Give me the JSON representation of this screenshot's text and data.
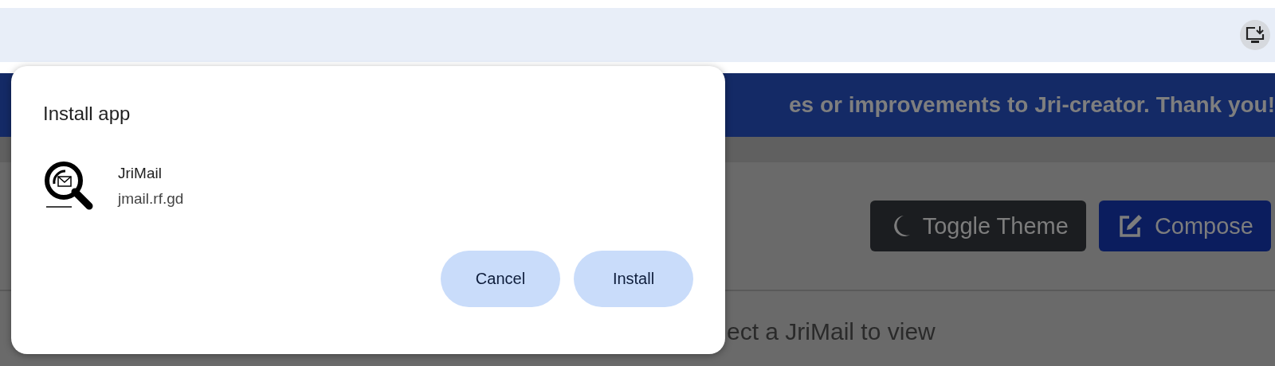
{
  "page": {
    "banner": "es or improvements to Jri-creator. Thank you!",
    "buttons": [
      {
        "label": "Toggle Theme",
        "kind": "theme"
      },
      {
        "label": "Compose",
        "kind": "compose"
      }
    ],
    "empty_message": "ect a JriMail to view"
  },
  "dialog": {
    "title": "Install app",
    "app_name": "JriMail",
    "app_url": "jmail.rf.gd",
    "buttons": [
      "Cancel",
      "Install"
    ]
  }
}
